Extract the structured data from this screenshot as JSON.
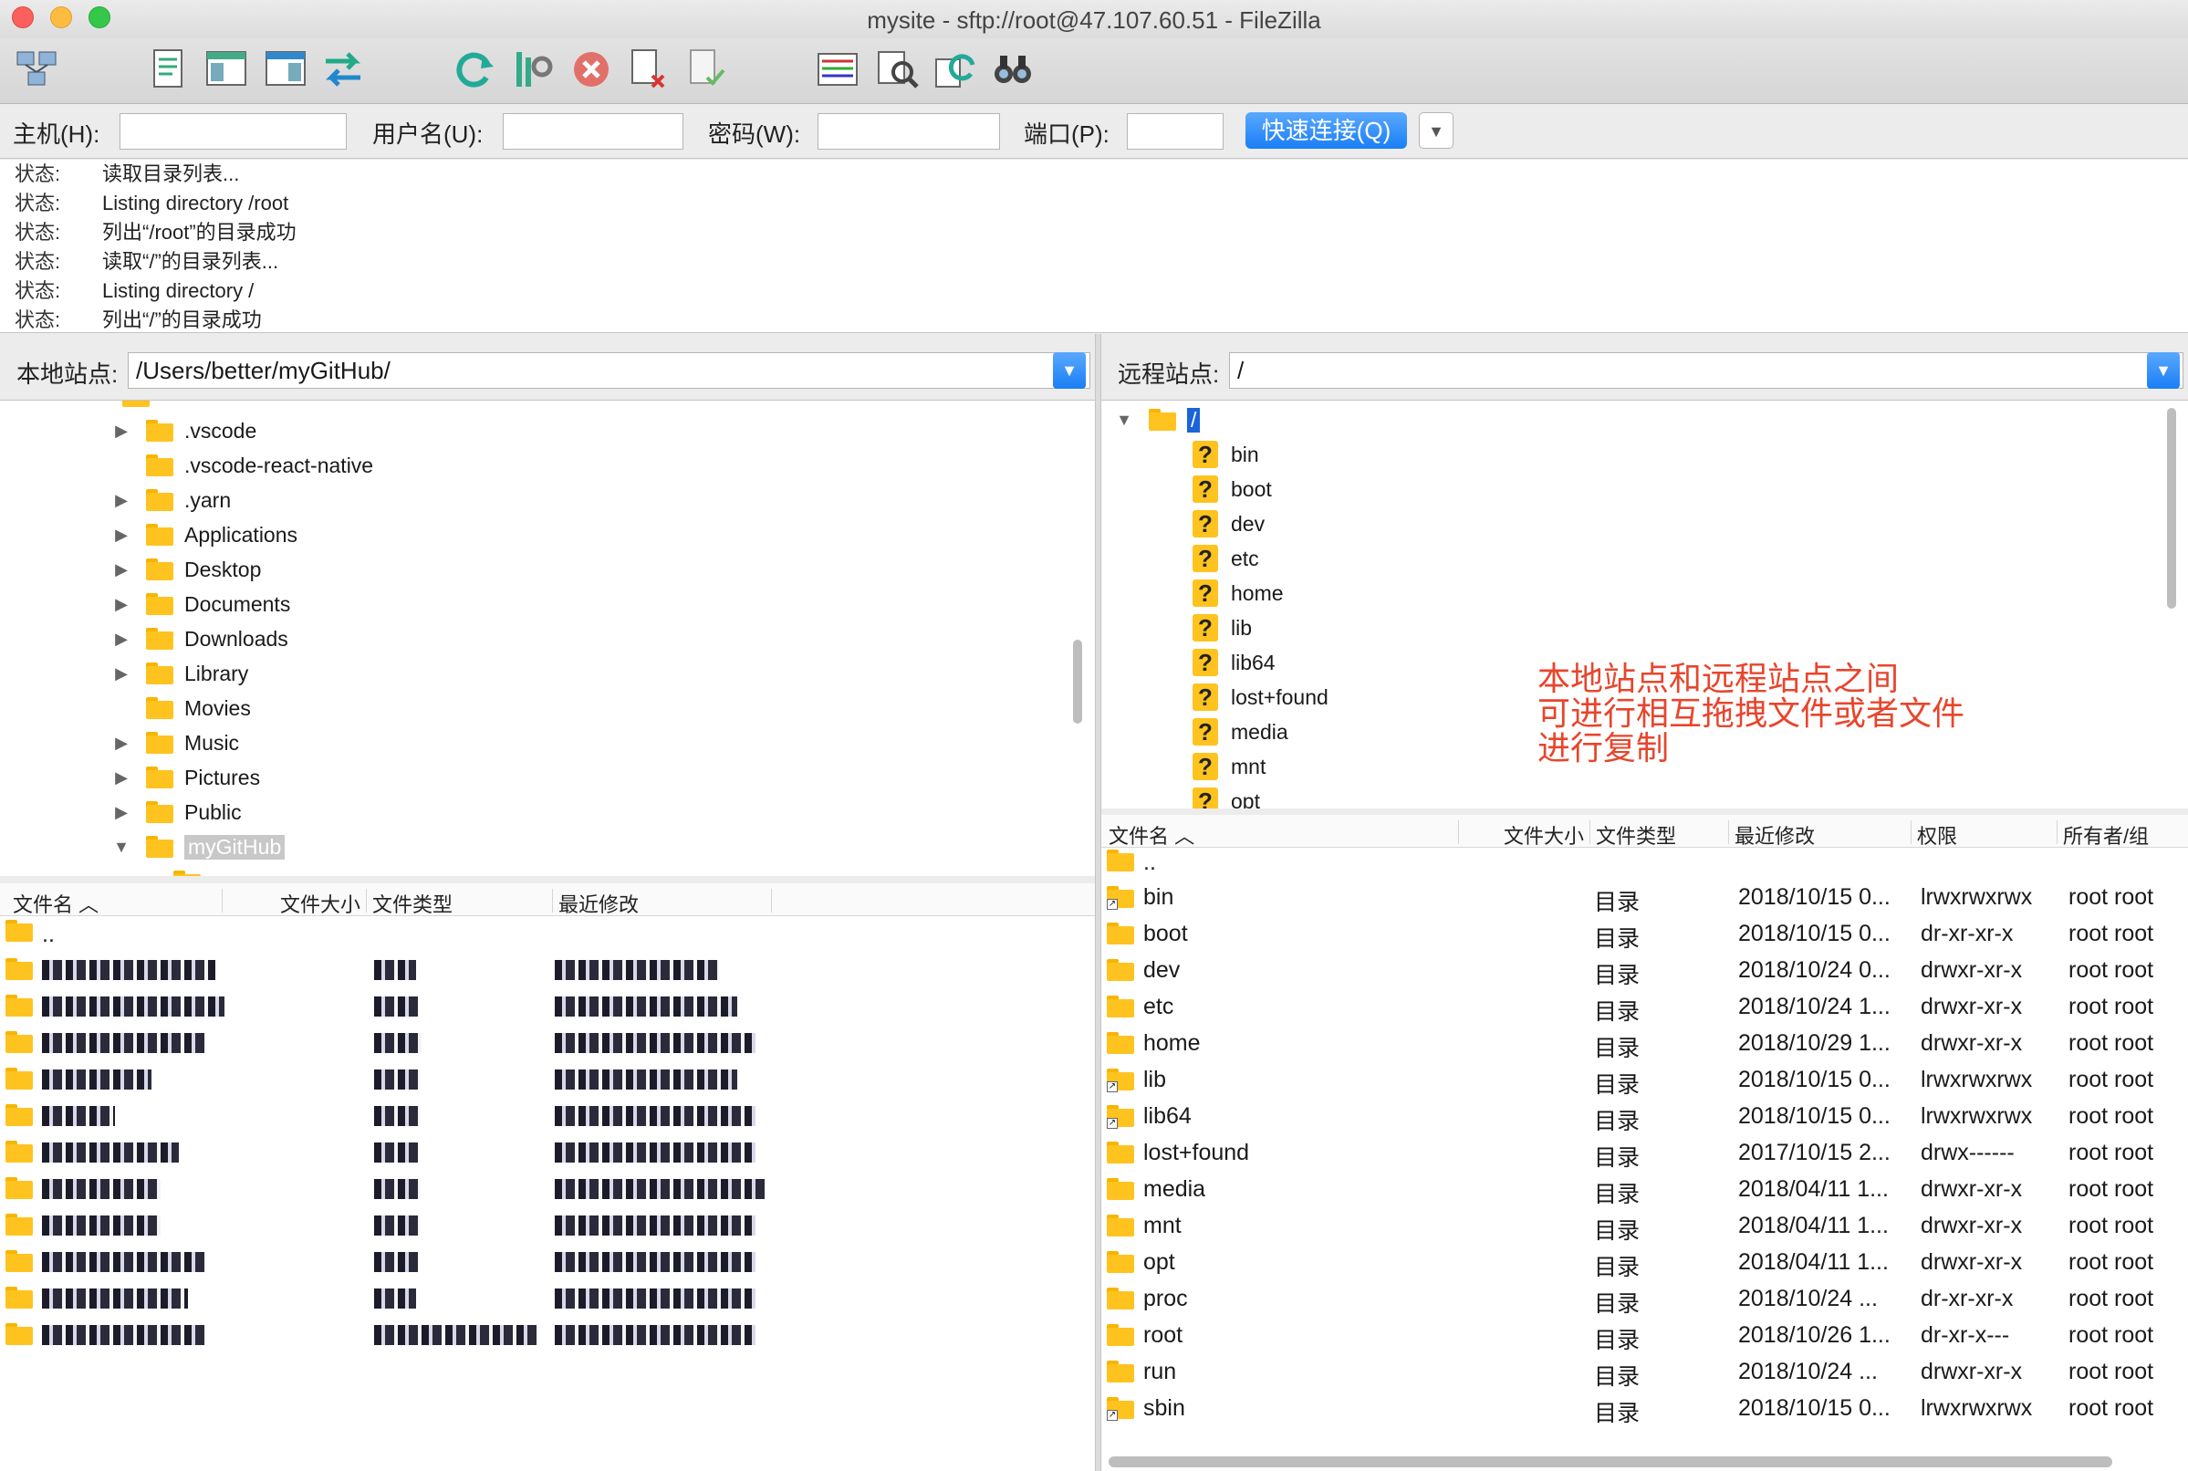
{
  "window": {
    "title": "mysite - sftp://root@47.107.60.51 - FileZilla"
  },
  "toolbar": {
    "buttons": [
      {
        "name": "site-manager-icon"
      },
      {
        "name": "toggle-log-icon"
      },
      {
        "name": "toggle-local-tree-icon"
      },
      {
        "name": "toggle-remote-tree-icon"
      },
      {
        "name": "transfer-queue-icon"
      },
      {
        "name": "refresh-icon"
      },
      {
        "name": "process-queue-icon"
      },
      {
        "name": "cancel-icon"
      },
      {
        "name": "disconnect-icon"
      },
      {
        "name": "reconnect-icon"
      },
      {
        "name": "directory-listing-filters-icon"
      },
      {
        "name": "toggle-dir-compare-icon"
      },
      {
        "name": "sync-browsing-icon"
      },
      {
        "name": "search-remote-icon"
      }
    ]
  },
  "quickconnect": {
    "host_label": "主机(H):",
    "user_label": "用户名(U):",
    "pass_label": "密码(W):",
    "port_label": "端口(P):",
    "connect_label": "快速连接(Q)",
    "host": "",
    "user": "",
    "pass": "",
    "port": ""
  },
  "log": [
    {
      "k": "状态:",
      "v": "读取目录列表..."
    },
    {
      "k": "状态:",
      "v": "Listing directory /root"
    },
    {
      "k": "状态:",
      "v": "列出“/root”的目录成功"
    },
    {
      "k": "状态:",
      "v": "读取“/”的目录列表..."
    },
    {
      "k": "状态:",
      "v": "Listing directory /"
    },
    {
      "k": "状态:",
      "v": "列出“/”的目录成功"
    }
  ],
  "local": {
    "site_label": "本地站点:",
    "path": "/Users/better/myGitHub/",
    "tree": [
      {
        "name": ".vscode",
        "expandable": true
      },
      {
        "name": ".vscode-react-native",
        "expandable": false
      },
      {
        "name": ".yarn",
        "expandable": true
      },
      {
        "name": "Applications",
        "expandable": true
      },
      {
        "name": "Desktop",
        "expandable": true
      },
      {
        "name": "Documents",
        "expandable": true
      },
      {
        "name": "Downloads",
        "expandable": true
      },
      {
        "name": "Library",
        "expandable": true
      },
      {
        "name": "Movies",
        "expandable": false
      },
      {
        "name": "Music",
        "expandable": true
      },
      {
        "name": "Pictures",
        "expandable": true
      },
      {
        "name": "Public",
        "expandable": true
      },
      {
        "name": "myGitHub",
        "expandable": true,
        "expanded": true,
        "selected": true
      }
    ],
    "columns": [
      "文件名",
      "文件大小",
      "文件类型",
      "最近修改"
    ],
    "parent_row": "..",
    "rows": 11
  },
  "remote": {
    "site_label": "远程站点:",
    "path": "/",
    "root": "/",
    "tree": [
      "bin",
      "boot",
      "dev",
      "etc",
      "home",
      "lib",
      "lib64",
      "lost+found",
      "media",
      "mnt",
      "opt"
    ],
    "columns": [
      "文件名",
      "文件大小",
      "文件类型",
      "最近修改",
      "权限",
      "所有者/组"
    ],
    "parent_row": "..",
    "rows": [
      {
        "name": "bin",
        "type": "目录",
        "modified": "2018/10/15 0...",
        "perm": "lrwxrwxrwx",
        "owner": "root root",
        "link": true
      },
      {
        "name": "boot",
        "type": "目录",
        "modified": "2018/10/15 0...",
        "perm": "dr-xr-xr-x",
        "owner": "root root",
        "link": false
      },
      {
        "name": "dev",
        "type": "目录",
        "modified": "2018/10/24 0...",
        "perm": "drwxr-xr-x",
        "owner": "root root",
        "link": false
      },
      {
        "name": "etc",
        "type": "目录",
        "modified": "2018/10/24 1...",
        "perm": "drwxr-xr-x",
        "owner": "root root",
        "link": false
      },
      {
        "name": "home",
        "type": "目录",
        "modified": "2018/10/29 1...",
        "perm": "drwxr-xr-x",
        "owner": "root root",
        "link": false
      },
      {
        "name": "lib",
        "type": "目录",
        "modified": "2018/10/15 0...",
        "perm": "lrwxrwxrwx",
        "owner": "root root",
        "link": true
      },
      {
        "name": "lib64",
        "type": "目录",
        "modified": "2018/10/15 0...",
        "perm": "lrwxrwxrwx",
        "owner": "root root",
        "link": true
      },
      {
        "name": "lost+found",
        "type": "目录",
        "modified": "2017/10/15 2...",
        "perm": "drwx------",
        "owner": "root root",
        "link": false
      },
      {
        "name": "media",
        "type": "目录",
        "modified": "2018/04/11 1...",
        "perm": "drwxr-xr-x",
        "owner": "root root",
        "link": false
      },
      {
        "name": "mnt",
        "type": "目录",
        "modified": "2018/04/11 1...",
        "perm": "drwxr-xr-x",
        "owner": "root root",
        "link": false
      },
      {
        "name": "opt",
        "type": "目录",
        "modified": "2018/04/11 1...",
        "perm": "drwxr-xr-x",
        "owner": "root root",
        "link": false
      },
      {
        "name": "proc",
        "type": "目录",
        "modified": "2018/10/24 ...",
        "perm": "dr-xr-xr-x",
        "owner": "root root",
        "link": false
      },
      {
        "name": "root",
        "type": "目录",
        "modified": "2018/10/26 1...",
        "perm": "dr-xr-x---",
        "owner": "root root",
        "link": false
      },
      {
        "name": "run",
        "type": "目录",
        "modified": "2018/10/24 ...",
        "perm": "drwxr-xr-x",
        "owner": "root root",
        "link": false
      },
      {
        "name": "sbin",
        "type": "目录",
        "modified": "2018/10/15 0...",
        "perm": "lrwxrwxrwx",
        "owner": "root root",
        "link": true
      }
    ]
  },
  "annotation": {
    "lines": [
      "本地站点和远程站点之间",
      "可进行相互拖拽文件或者文件",
      "进行复制"
    ],
    "color": "#e8452c"
  },
  "colors": {
    "accent": "#1a7ef5",
    "folder": "#ffc31f",
    "selection": "#1a64d8"
  }
}
